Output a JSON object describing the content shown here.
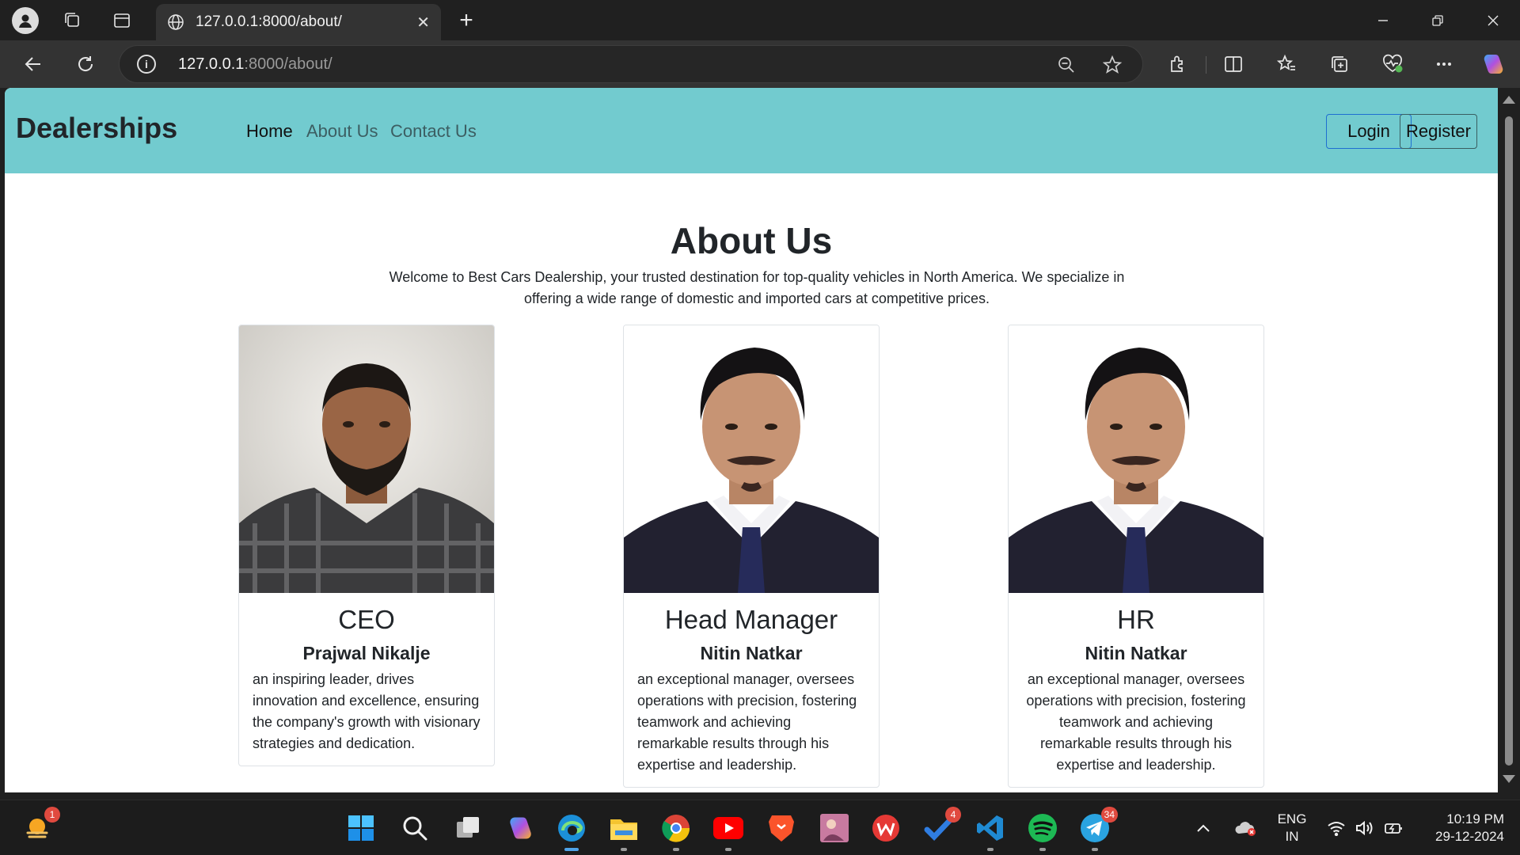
{
  "browser": {
    "tab_title": "127.0.0.1:8000/about/",
    "tab_close": "✕",
    "new_tab": "+",
    "url_host": "127.0.0.1",
    "url_path": ":8000/about/",
    "info_glyph": "i"
  },
  "site": {
    "brand": "Dealerships",
    "nav": {
      "home": "Home",
      "about": "About Us",
      "contact": "Contact Us"
    },
    "buttons": {
      "login": "Login",
      "register": "Register"
    }
  },
  "about": {
    "title": "About Us",
    "intro": "Welcome to Best Cars Dealership, your trusted destination for top-quality vehicles in North America. We specialize in offering a wide range of domestic and imported cars at competitive prices."
  },
  "cards": [
    {
      "role": "CEO",
      "name": "Prajwal Nikalje",
      "desc": "an inspiring leader, drives innovation and excellence, ensuring the company's growth with visionary strategies and dedication."
    },
    {
      "role": "Head Manager",
      "name": "Nitin Natkar",
      "desc": "an exceptional manager, oversees operations with precision, fostering teamwork and achieving remarkable results through his expertise and leadership."
    },
    {
      "role": "HR",
      "name": "Nitin Natkar",
      "desc": "an exceptional manager, oversees operations with precision, fostering teamwork and achieving remarkable results through his expertise and leadership."
    }
  ],
  "taskbar": {
    "weather_badge": "1",
    "todo_badge": "4",
    "telegram_badge": "34",
    "lang_line1": "ENG",
    "lang_line2": "IN",
    "time": "10:19 PM",
    "date": "29-12-2024"
  }
}
